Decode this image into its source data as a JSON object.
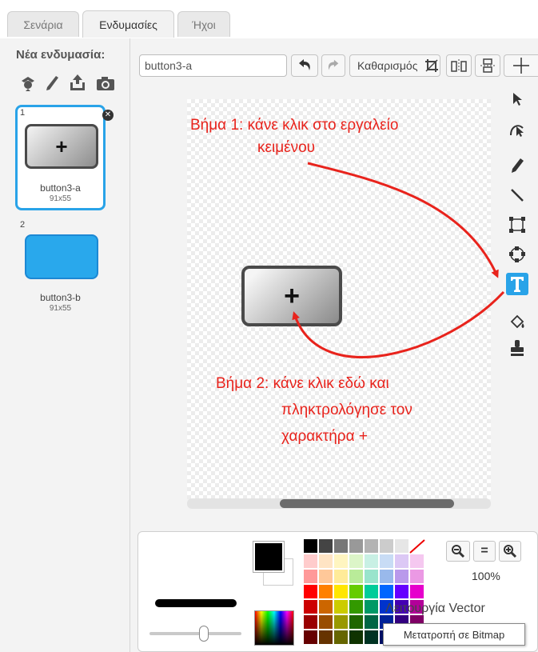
{
  "tabs": [
    {
      "label": "Σενάρια"
    },
    {
      "label": "Ενδυμασίες"
    },
    {
      "label": "Ήχοι"
    }
  ],
  "left": {
    "new_costume_label": "Νέα ενδυμασία:",
    "icons": [
      "sprite-library-icon",
      "paint-brush-icon",
      "upload-icon",
      "camera-icon"
    ],
    "costumes": [
      {
        "number": "1",
        "name": "button3-a",
        "size": "91x55",
        "glyph": "+"
      },
      {
        "number": "2",
        "name": "button3-b",
        "size": "91x55"
      }
    ]
  },
  "editor": {
    "costume_name": "button3-a",
    "clear_label": "Καθαρισμός",
    "annotation_step1": [
      "Βήμα 1: κάνε κλικ στο εργαλείο",
      "κειμένου"
    ],
    "annotation_step2": [
      "Βήμα 2: κάνε κλικ εδώ και",
      "πληκτρολόγησε τον",
      "χαρακτήρα  +"
    ],
    "canvas_button_glyph": "+",
    "tools": [
      "select-icon",
      "reshape-icon",
      "pencil-icon",
      "line-icon",
      "rectangle-icon",
      "ellipse-icon",
      "text-icon",
      "fill-icon",
      "stamp-icon"
    ],
    "active_tool": "text-icon"
  },
  "bottom": {
    "zoom_level": "100%",
    "mode_label": "Λειτουργία Vector",
    "convert_tooltip": "Μετατροπή σε Bitmap",
    "zoom_buttons": {
      "out": "-",
      "reset": "=",
      "in": "+"
    },
    "palette_rows": [
      [
        "#000000",
        "#444444",
        "#777777",
        "#999999",
        "#b3b3b3",
        "#cccccc",
        "#e6e6e6",
        "#ffffff"
      ],
      [
        "#ffcccc",
        "#ffe4c4",
        "#fff5c0",
        "#dcf5c8",
        "#c8f0e4",
        "#c8dcf5",
        "#dcc8f5",
        "#f5c8f0"
      ],
      [
        "#ff9999",
        "#ffc899",
        "#ffeb99",
        "#b9eb99",
        "#99e4cc",
        "#99b9eb",
        "#b999eb",
        "#eb99e4"
      ],
      [
        "#ff0000",
        "#ff8000",
        "#ffe600",
        "#66cc00",
        "#00cc99",
        "#0066ff",
        "#6600ff",
        "#e600cc"
      ],
      [
        "#cc0000",
        "#cc6600",
        "#cccc00",
        "#339900",
        "#009966",
        "#0033cc",
        "#4400b3",
        "#b30099"
      ],
      [
        "#990000",
        "#994d00",
        "#999900",
        "#1f6600",
        "#006644",
        "#002299",
        "#330080",
        "#800066"
      ],
      [
        "#660000",
        "#663300",
        "#666600",
        "#0f3300",
        "#003322",
        "#001166",
        "#1f004d",
        "#4d0040"
      ]
    ],
    "primary_color": "#000000",
    "secondary_color": "#ffffff"
  }
}
